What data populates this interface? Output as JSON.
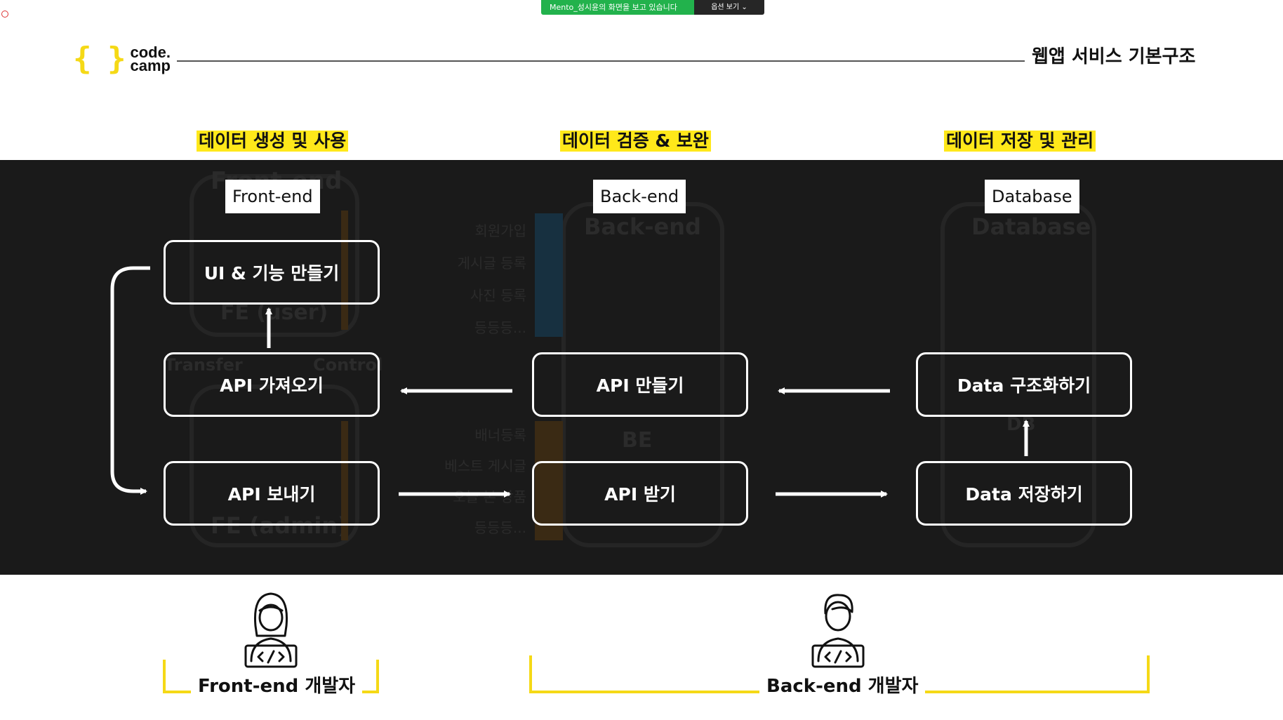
{
  "zoom": {
    "share_text": "Mento_성시윤의 화면을 보고 있습니다",
    "options_label": "옵션 보기 ⌄"
  },
  "header": {
    "logo_braces": "{ }",
    "logo_line1": "code.",
    "logo_line2": "camp",
    "title": "웹앱 서비스 기본구조"
  },
  "categories": {
    "frontend": "데이터 생성 및 사용",
    "backend": "데이터 검증 & 보완",
    "database": "데이터 저장 및 관리"
  },
  "tags": {
    "frontend": "Front-end",
    "backend": "Back-end",
    "database": "Database"
  },
  "nodes": {
    "ui": "UI & 기능 만들기",
    "api_fetch": "API 가져오기",
    "api_send": "API 보내기",
    "api_make": "API 만들기",
    "api_receive": "API 받기",
    "data_structure": "Data 구조화하기",
    "data_store": "Data 저장하기"
  },
  "background_ghost": {
    "fe_title": "Front-end",
    "fe_user": "FE (user)",
    "fe_admin": "FE (admin)",
    "transfer": "Transfer",
    "control": "Control",
    "be_title": "Back-end",
    "be": "BE",
    "db_title": "Database",
    "db": "DB",
    "be_list_top": [
      "회원가입",
      "게시글 등록",
      "사진 등록",
      "등등등..."
    ],
    "be_list_bottom": [
      "배너등록",
      "베스트 게시글",
      "오늘 본 상품",
      "등등등..."
    ]
  },
  "developers": {
    "frontend": "Front-end 개발자",
    "backend": "Back-end 개발자"
  },
  "colors": {
    "accent_yellow": "#f5d916",
    "highlight_yellow": "#ffe81a",
    "dark_band": "#1a1a1a",
    "zoom_green": "#22b24c"
  }
}
